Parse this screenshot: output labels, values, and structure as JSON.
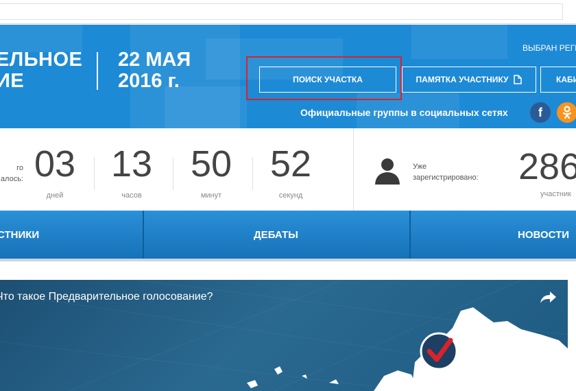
{
  "hero": {
    "title": "ЕЛЬНОЕ\nИЕ",
    "date": "22 МАЯ\n2016 г.",
    "region_label": "ВЫБРАН РЕГИ",
    "buttons": {
      "search": "ПОИСК УЧАСТКА",
      "memo": "ПАМЯТКА УЧАСТНИКУ",
      "cabinet": "КАБИ"
    },
    "social_text": "Официальные группы в социальных сетях",
    "social_icons": [
      "facebook-icon",
      "odnoklassniki-icon"
    ],
    "accent_color": "#1d8ad6",
    "highlight_color": "#d9232a"
  },
  "countdown": {
    "label": "го\nалось:",
    "units": [
      {
        "value": "03",
        "label": "дней"
      },
      {
        "value": "13",
        "label": "часов"
      },
      {
        "value": "50",
        "label": "минут"
      },
      {
        "value": "52",
        "label": "секунд"
      }
    ]
  },
  "registered": {
    "label": "Уже\nзарегистрировано:",
    "value": "286",
    "sub": "участник"
  },
  "nav": {
    "items": [
      "СТНИКИ",
      "ДЕБАТЫ",
      "НОВОСТИ"
    ]
  },
  "video": {
    "title": "Что такое Предварительное голосование?"
  }
}
